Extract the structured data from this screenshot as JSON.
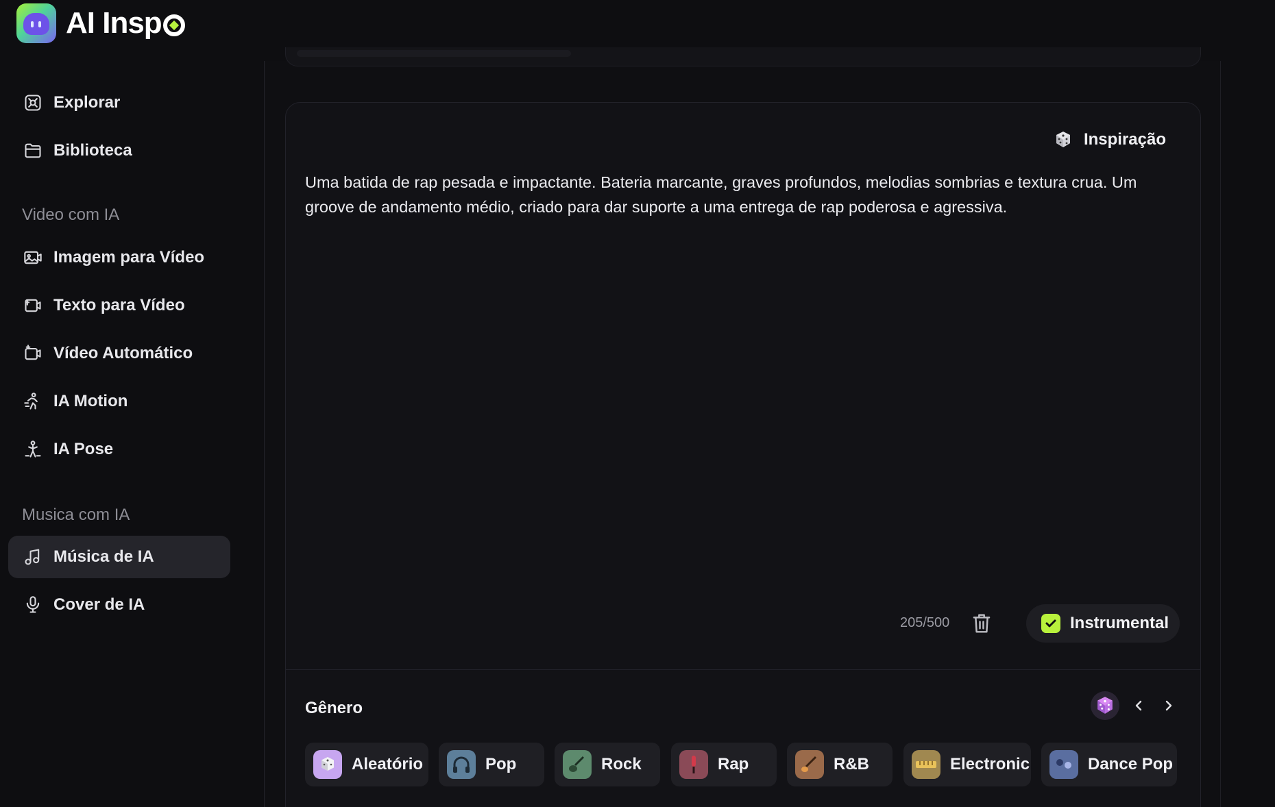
{
  "brand": {
    "name": "AI Insp"
  },
  "sidebar": {
    "items_top": [
      {
        "label": "Explorar",
        "icon": "explore-icon"
      },
      {
        "label": "Biblioteca",
        "icon": "folder-icon"
      }
    ],
    "section_video": "Video com IA",
    "items_video": [
      {
        "label": "Imagem para Vídeo",
        "icon": "image-to-video-icon"
      },
      {
        "label": "Texto para Vídeo",
        "icon": "text-to-video-icon"
      },
      {
        "label": "Vídeo Automático",
        "icon": "auto-video-icon"
      },
      {
        "label": "IA Motion",
        "icon": "motion-icon"
      },
      {
        "label": "IA Pose",
        "icon": "pose-icon"
      }
    ],
    "section_music": "Musica com IA",
    "items_music": [
      {
        "label": "Música de IA",
        "icon": "music-icon",
        "active": true
      },
      {
        "label": "Cover de IA",
        "icon": "mic-icon"
      }
    ]
  },
  "prompt_card": {
    "inspiration_label": "Inspiração",
    "prompt_text": "Uma batida de rap pesada e impactante. Bateria marcante, graves profundos, melodias sombrias e textura crua. Um groove de andamento médio, criado para dar suporte a uma entrega de rap poderosa e agressiva.",
    "char_counter": "205/500",
    "instrumental_label": "Instrumental",
    "instrumental_checked": true
  },
  "genre": {
    "title": "Gênero",
    "chips": [
      {
        "label": "Aleatório",
        "thumb_color": "#c7a6f0"
      },
      {
        "label": "Pop",
        "thumb_color": "#5d7f9a"
      },
      {
        "label": "Rock",
        "thumb_color": "#5d8a6d"
      },
      {
        "label": "Rap",
        "thumb_color": "#8a4a57"
      },
      {
        "label": "R&B",
        "thumb_color": "#9a6a4a"
      },
      {
        "label": "Electronic",
        "thumb_color": "#a08850"
      },
      {
        "label": "Dance Pop",
        "thumb_color": "#5a6ea0"
      }
    ]
  },
  "colors": {
    "accent": "#b8f13c",
    "background": "#0f0f12",
    "card": "#121216",
    "active_nav": "#25252b"
  }
}
